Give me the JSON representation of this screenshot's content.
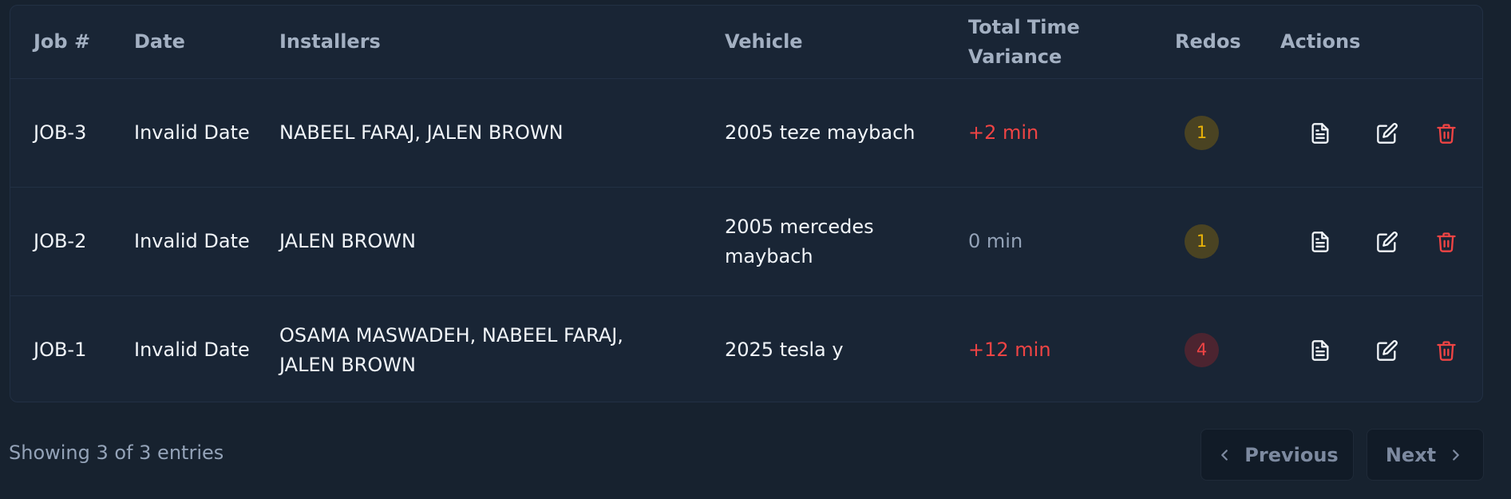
{
  "table": {
    "headers": {
      "job": "Job #",
      "date": "Date",
      "installers": "Installers",
      "vehicle": "Vehicle",
      "variance": "Total Time Variance",
      "redos": "Redos",
      "actions": "Actions"
    },
    "rows": [
      {
        "job": "JOB-3",
        "date": "Invalid Date",
        "installers": "NABEEL FARAJ, JALEN BROWN",
        "vehicle": "2005 teze maybach",
        "variance": "+2 min",
        "redos": "1"
      },
      {
        "job": "JOB-2",
        "date": "Invalid Date",
        "installers": "JALEN BROWN",
        "vehicle": "2005 mercedes maybach",
        "variance": "0 min",
        "redos": "1"
      },
      {
        "job": "JOB-1",
        "date": "Invalid Date",
        "installers": "OSAMA MASWADEH, NABEEL FARAJ, JALEN BROWN",
        "vehicle": "2025 tesla y",
        "variance": "+12 min",
        "redos": "4"
      }
    ],
    "action_icons": [
      "document-icon",
      "edit-icon",
      "trash-icon"
    ]
  },
  "footer": {
    "summary": "Showing 3 of 3 entries",
    "prev_label": "Previous",
    "next_label": "Next"
  },
  "colors": {
    "background": "#17222f",
    "card": "#192535",
    "danger": "#ef4444",
    "warning": "#eab308",
    "muted": "#94a3b8"
  }
}
